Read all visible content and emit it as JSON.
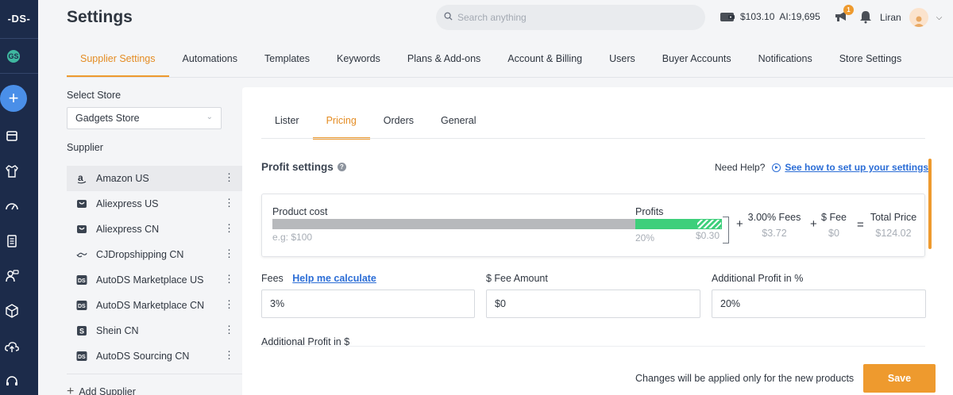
{
  "app": {
    "logo": "-DS-",
    "workspace_badge": "GS",
    "create_label": "+"
  },
  "header": {
    "title": "Settings",
    "search_placeholder": "Search anything",
    "balance": "$103.10",
    "ai_credits": "AI:19,695",
    "notifications_count": "1",
    "user_name": "Liran"
  },
  "top_tabs": [
    {
      "label": "Supplier Settings",
      "active": true
    },
    {
      "label": "Automations"
    },
    {
      "label": "Templates"
    },
    {
      "label": "Keywords"
    },
    {
      "label": "Plans & Add-ons"
    },
    {
      "label": "Account & Billing"
    },
    {
      "label": "Users"
    },
    {
      "label": "Buyer Accounts"
    },
    {
      "label": "Notifications"
    },
    {
      "label": "Store Settings"
    }
  ],
  "left_panel": {
    "select_store_label": "Select Store",
    "store_value": "Gadgets Store",
    "supplier_label": "Supplier",
    "suppliers": [
      {
        "name": "Amazon US",
        "icon": "amazon-icon",
        "active": true
      },
      {
        "name": "Aliexpress US",
        "icon": "aliexpress-icon"
      },
      {
        "name": "Aliexpress CN",
        "icon": "aliexpress-icon"
      },
      {
        "name": "CJDropshipping CN",
        "icon": "cj-icon"
      },
      {
        "name": "AutoDS Marketplace US",
        "icon": "autods-icon"
      },
      {
        "name": "AutoDS Marketplace CN",
        "icon": "autods-icon"
      },
      {
        "name": "Shein CN",
        "icon": "shein-icon"
      },
      {
        "name": "AutoDS Sourcing CN",
        "icon": "autods-icon"
      }
    ],
    "add_supplier": "Add Supplier"
  },
  "sub_tabs": [
    {
      "label": "Lister"
    },
    {
      "label": "Pricing",
      "active": true
    },
    {
      "label": "Orders"
    },
    {
      "label": "General"
    }
  ],
  "pricing": {
    "title": "Profit settings",
    "need_help": "Need Help?",
    "help_link": "See how to set up your settings",
    "calc": {
      "product_cost_label": "Product cost",
      "product_cost_placeholder": "e.g: $100",
      "profits_label": "Profits",
      "profits_percent": "20%",
      "profits_fixed": "$0.30",
      "plus": "+",
      "equals": "=",
      "fees_label": "3.00% Fees",
      "fees_value": "$3.72",
      "fee_label": "$ Fee",
      "fee_value": "$0",
      "total_label": "Total Price",
      "total_value": "$124.02"
    },
    "fields": {
      "fees_label": "Fees",
      "fees_help": "Help me calculate",
      "fees_value": "3%",
      "fee_amount_label": "$ Fee Amount",
      "fee_amount_value": "$0",
      "additional_profit_pct_label": "Additional Profit in %",
      "additional_profit_pct_value": "20%",
      "additional_profit_usd_label": "Additional Profit in $"
    },
    "notice": "Changes will be applied only for the new products",
    "save_label": "Save"
  },
  "colors": {
    "accent": "#ee9a2e",
    "rail": "#1c2b4a",
    "profit": "#3ecf7b",
    "link": "#2b6dd6"
  }
}
